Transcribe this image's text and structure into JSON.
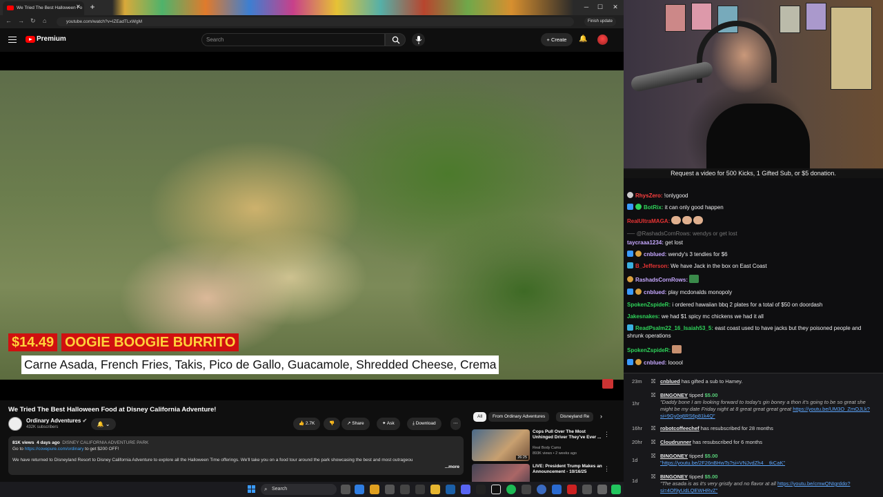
{
  "browser": {
    "tab_title": "We Tried The Best Halloween Fo",
    "url": "youtube.com/watch?v=IZEadTLxWgM",
    "finish_update": "Finish update"
  },
  "youtube": {
    "brand": "Premium",
    "search_placeholder": "Search",
    "create_label": "Create",
    "video_overlay": {
      "price": "$14.49",
      "item": "OOGIE BOOGIE BURRITO",
      "ingredients": "Carne Asada, French Fries, Takis, Pico de Gallo, Guacamole, Shredded Cheese, Crema"
    },
    "video_title": "We Tried The Best Halloween Food at Disney California Adventure!",
    "channel_name": "Ordinary Adventures",
    "channel_subs": "432K subscribers",
    "likes": "2.7K",
    "share_label": "Share",
    "ask_label": "Ask",
    "download_label": "Download",
    "description": {
      "views": "81K views",
      "age": "4 days ago",
      "tags": "DISNEY CALIFORNIA ADVENTURE PARK",
      "goto_prefix": "Go to",
      "goto_link": "https://covepure.com/ordinary",
      "goto_suffix": "to get $200 OFF!",
      "body": "We have returned to Disneyland Resort to Disney California Adventure to explore all the Halloween Time offerings. We'll take you on a food tour around the park showcasing the best and most outrageou",
      "more": "...more"
    },
    "chips": [
      "All",
      "From Ordinary Adventures",
      "Disneyland Re"
    ],
    "recommendations": [
      {
        "title": "Cops Pull Over The Most Unhinged Driver They've Ever ...",
        "channel": "Real Body Cams",
        "meta": "893K views • 2 weeks ago",
        "duration": "26:25"
      },
      {
        "title": "LIVE: President Trump Makes an Announcement - 10/16/25",
        "channel": "",
        "meta": "",
        "duration": ""
      }
    ]
  },
  "taskbar": {
    "search_label": "Search"
  },
  "stream": {
    "banner": "Request a video for 500 Kicks, 1 Gifted Sub, or $5 donation.",
    "chat": [
      {
        "user": "RhysZero:",
        "color": "#ff4040",
        "text": "!onlygood"
      },
      {
        "user": "BotRix:",
        "color": "#2fd35a",
        "text": "it can only good happen"
      },
      {
        "user": "RealUltraMAGA:",
        "color": "#e83434",
        "text": ""
      },
      {
        "user": "@RashadsCornRows:",
        "color": "#777777",
        "text": "wendys or get lost"
      },
      {
        "user": "taycraaa1234:",
        "color": "#c6a8ff",
        "text": "get lost"
      },
      {
        "user": "cnblued:",
        "color": "#c6a8ff",
        "text": "wendy's 3 tendies for $6"
      },
      {
        "user": "B_Jefferson:",
        "color": "#e83434",
        "text": "We have Jack in the box on East Coast"
      },
      {
        "user": "RashadsCornRows:",
        "color": "#c6a8ff",
        "text": ""
      },
      {
        "user": "cnblued:",
        "color": "#c6a8ff",
        "text": "play mcdonalds monopoly"
      },
      {
        "user": "SpokenZspideR:",
        "color": "#2fd35a",
        "text": "i ordered hawaiian bbq 2 plates for a total of $50 on doordash"
      },
      {
        "user": "Jakesnakes:",
        "color": "#2fd35a",
        "text": "we had $1 spicy mc chickens we had it all"
      },
      {
        "user": "ReadPsalm22_16_Isaiah53_5:",
        "color": "#2fd35a",
        "text": "east coast used to have jacks but they poisoned people and shrunk operations"
      },
      {
        "user": "SpokenZspideR:",
        "color": "#2fd35a",
        "text": ""
      },
      {
        "user": "cnblued:",
        "color": "#c6a8ff",
        "text": "looool"
      }
    ],
    "events": [
      {
        "time": "23m",
        "user": "cnblued",
        "text": "has gifted a sub to Hamey."
      },
      {
        "time": "1hr",
        "user": "BINGONEY",
        "text": "tipped",
        "amount": "$5.00",
        "quote": "\"Daddy bone I am looking forward to today's gin boney a thon it's going to be so great she might be my date Friday night at 8 great great great great",
        "link": "https://youtu.be/UM3O_ZmOJLk?si=9Gy0q8RS6p81k4Q\""
      },
      {
        "time": "16hr",
        "user": "robotcoffeechef",
        "text": "has resubscribed for 28 months"
      },
      {
        "time": "20hr",
        "user": "Cloudrunner",
        "text": "has resubscribed for 6 months"
      },
      {
        "time": "1d",
        "user": "BINGONEY",
        "text": "tipped",
        "amount": "$5.00",
        "quote": "",
        "link": "\"https://youtu.be/2F26nBHwTs?si=VNJvdZh4__tkCaK\""
      },
      {
        "time": "1d",
        "user": "BINGONEY",
        "text": "tipped",
        "amount": "$5.00",
        "quote": "\"The asada is as it's very gristly and no flavor at all",
        "link": "https://youtu.be/cmwQNIgrddo?si=4Of9yUdLQEWHRvZ\""
      }
    ]
  },
  "colors": {
    "yt_red": "#ff0000",
    "overlay_red": "#d01010",
    "overlay_yellow": "#ffd23a",
    "tip_green": "#58d27a"
  }
}
